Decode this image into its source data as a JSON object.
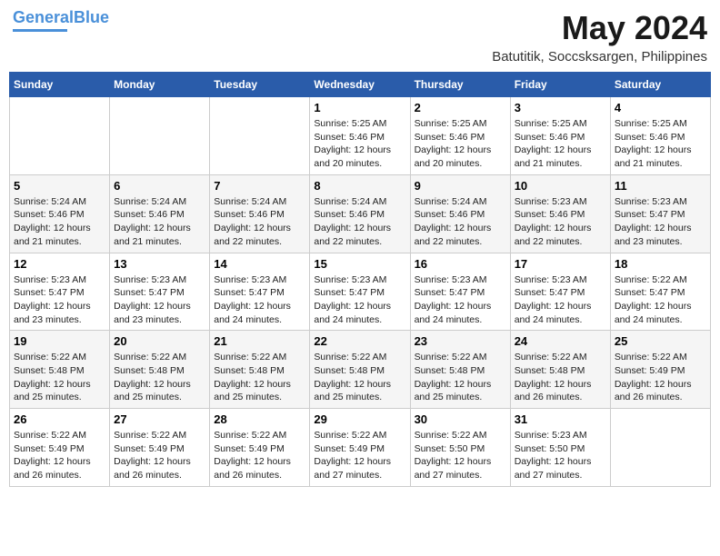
{
  "header": {
    "logo_line1": "General",
    "logo_line2": "Blue",
    "month": "May 2024",
    "location": "Batutitik, Soccsksargen, Philippines"
  },
  "days_of_week": [
    "Sunday",
    "Monday",
    "Tuesday",
    "Wednesday",
    "Thursday",
    "Friday",
    "Saturday"
  ],
  "weeks": [
    [
      {
        "day": "",
        "info": ""
      },
      {
        "day": "",
        "info": ""
      },
      {
        "day": "",
        "info": ""
      },
      {
        "day": "1",
        "info": "Sunrise: 5:25 AM\nSunset: 5:46 PM\nDaylight: 12 hours\nand 20 minutes."
      },
      {
        "day": "2",
        "info": "Sunrise: 5:25 AM\nSunset: 5:46 PM\nDaylight: 12 hours\nand 20 minutes."
      },
      {
        "day": "3",
        "info": "Sunrise: 5:25 AM\nSunset: 5:46 PM\nDaylight: 12 hours\nand 21 minutes."
      },
      {
        "day": "4",
        "info": "Sunrise: 5:25 AM\nSunset: 5:46 PM\nDaylight: 12 hours\nand 21 minutes."
      }
    ],
    [
      {
        "day": "5",
        "info": "Sunrise: 5:24 AM\nSunset: 5:46 PM\nDaylight: 12 hours\nand 21 minutes."
      },
      {
        "day": "6",
        "info": "Sunrise: 5:24 AM\nSunset: 5:46 PM\nDaylight: 12 hours\nand 21 minutes."
      },
      {
        "day": "7",
        "info": "Sunrise: 5:24 AM\nSunset: 5:46 PM\nDaylight: 12 hours\nand 22 minutes."
      },
      {
        "day": "8",
        "info": "Sunrise: 5:24 AM\nSunset: 5:46 PM\nDaylight: 12 hours\nand 22 minutes."
      },
      {
        "day": "9",
        "info": "Sunrise: 5:24 AM\nSunset: 5:46 PM\nDaylight: 12 hours\nand 22 minutes."
      },
      {
        "day": "10",
        "info": "Sunrise: 5:23 AM\nSunset: 5:46 PM\nDaylight: 12 hours\nand 22 minutes."
      },
      {
        "day": "11",
        "info": "Sunrise: 5:23 AM\nSunset: 5:47 PM\nDaylight: 12 hours\nand 23 minutes."
      }
    ],
    [
      {
        "day": "12",
        "info": "Sunrise: 5:23 AM\nSunset: 5:47 PM\nDaylight: 12 hours\nand 23 minutes."
      },
      {
        "day": "13",
        "info": "Sunrise: 5:23 AM\nSunset: 5:47 PM\nDaylight: 12 hours\nand 23 minutes."
      },
      {
        "day": "14",
        "info": "Sunrise: 5:23 AM\nSunset: 5:47 PM\nDaylight: 12 hours\nand 24 minutes."
      },
      {
        "day": "15",
        "info": "Sunrise: 5:23 AM\nSunset: 5:47 PM\nDaylight: 12 hours\nand 24 minutes."
      },
      {
        "day": "16",
        "info": "Sunrise: 5:23 AM\nSunset: 5:47 PM\nDaylight: 12 hours\nand 24 minutes."
      },
      {
        "day": "17",
        "info": "Sunrise: 5:23 AM\nSunset: 5:47 PM\nDaylight: 12 hours\nand 24 minutes."
      },
      {
        "day": "18",
        "info": "Sunrise: 5:22 AM\nSunset: 5:47 PM\nDaylight: 12 hours\nand 24 minutes."
      }
    ],
    [
      {
        "day": "19",
        "info": "Sunrise: 5:22 AM\nSunset: 5:48 PM\nDaylight: 12 hours\nand 25 minutes."
      },
      {
        "day": "20",
        "info": "Sunrise: 5:22 AM\nSunset: 5:48 PM\nDaylight: 12 hours\nand 25 minutes."
      },
      {
        "day": "21",
        "info": "Sunrise: 5:22 AM\nSunset: 5:48 PM\nDaylight: 12 hours\nand 25 minutes."
      },
      {
        "day": "22",
        "info": "Sunrise: 5:22 AM\nSunset: 5:48 PM\nDaylight: 12 hours\nand 25 minutes."
      },
      {
        "day": "23",
        "info": "Sunrise: 5:22 AM\nSunset: 5:48 PM\nDaylight: 12 hours\nand 25 minutes."
      },
      {
        "day": "24",
        "info": "Sunrise: 5:22 AM\nSunset: 5:48 PM\nDaylight: 12 hours\nand 26 minutes."
      },
      {
        "day": "25",
        "info": "Sunrise: 5:22 AM\nSunset: 5:49 PM\nDaylight: 12 hours\nand 26 minutes."
      }
    ],
    [
      {
        "day": "26",
        "info": "Sunrise: 5:22 AM\nSunset: 5:49 PM\nDaylight: 12 hours\nand 26 minutes."
      },
      {
        "day": "27",
        "info": "Sunrise: 5:22 AM\nSunset: 5:49 PM\nDaylight: 12 hours\nand 26 minutes."
      },
      {
        "day": "28",
        "info": "Sunrise: 5:22 AM\nSunset: 5:49 PM\nDaylight: 12 hours\nand 26 minutes."
      },
      {
        "day": "29",
        "info": "Sunrise: 5:22 AM\nSunset: 5:49 PM\nDaylight: 12 hours\nand 27 minutes."
      },
      {
        "day": "30",
        "info": "Sunrise: 5:22 AM\nSunset: 5:50 PM\nDaylight: 12 hours\nand 27 minutes."
      },
      {
        "day": "31",
        "info": "Sunrise: 5:23 AM\nSunset: 5:50 PM\nDaylight: 12 hours\nand 27 minutes."
      },
      {
        "day": "",
        "info": ""
      }
    ]
  ]
}
